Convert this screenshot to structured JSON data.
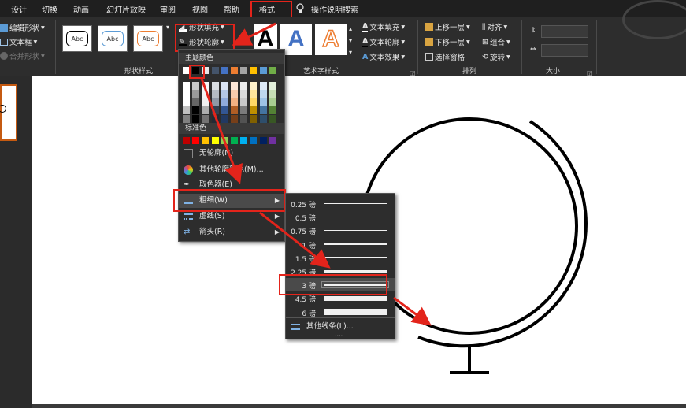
{
  "menubar": {
    "tabs": [
      "设计",
      "切换",
      "动画",
      "幻灯片放映",
      "审阅",
      "视图",
      "帮助",
      "格式"
    ],
    "active_tab": "格式",
    "search_label": "操作说明搜索"
  },
  "ribbon": {
    "insert_shapes": {
      "edit_shape": "编辑形状",
      "text_box": "文本框",
      "merge_shapes": "合并形状"
    },
    "shape_styles": {
      "group_label": "形状样式",
      "gallery": [
        "Abc",
        "Abc",
        "Abc"
      ],
      "shape_fill": "形状填充",
      "shape_outline": "形状轮廓"
    },
    "wordart": {
      "group_label": "艺术字样式",
      "letters": [
        "A",
        "A",
        "A"
      ],
      "text_fill": "文本填充",
      "text_outline": "文本轮廓",
      "text_effects": "文本效果"
    },
    "arrange": {
      "group_label": "排列",
      "bring_forward": "上移一层",
      "send_backward": "下移一层",
      "selection_pane": "选择窗格",
      "align": "对齐",
      "group": "组合",
      "rotate": "旋转"
    },
    "size": {
      "group_label": "大小",
      "height": "",
      "width": ""
    }
  },
  "outline_menu": {
    "theme_colors_label": "主题颜色",
    "standard_colors_label": "标准色",
    "no_outline": "无轮廓(N)",
    "more_colors": "其他轮廓颜色(M)...",
    "eyedropper": "取色器(E)",
    "weight": "粗细(W)",
    "dashes": "虚线(S)",
    "arrows": "箭头(R)",
    "theme_colors": [
      "#ffffff",
      "#000000",
      "#e7e6e6",
      "#44546a",
      "#4472c4",
      "#ed7d31",
      "#a5a5a5",
      "#ffc000",
      "#5b9bd5",
      "#70ad47"
    ],
    "standard_colors": [
      "#c00000",
      "#ff0000",
      "#ffc000",
      "#ffff00",
      "#92d050",
      "#00b050",
      "#00b0f0",
      "#0070c0",
      "#002060",
      "#7030a0"
    ]
  },
  "weight_menu": {
    "items": [
      {
        "label": "0.25 磅",
        "thickness": 0.25
      },
      {
        "label": "0.5 磅",
        "thickness": 0.5
      },
      {
        "label": "0.75 磅",
        "thickness": 0.75
      },
      {
        "label": "1 磅",
        "thickness": 1
      },
      {
        "label": "1.5 磅",
        "thickness": 1.5
      },
      {
        "label": "2.25 磅",
        "thickness": 2.25
      },
      {
        "label": "3 磅",
        "thickness": 3
      },
      {
        "label": "4.5 磅",
        "thickness": 4.5
      },
      {
        "label": "6 磅",
        "thickness": 6
      }
    ],
    "selected": "3 磅",
    "more_lines": "其他线条(L)..."
  },
  "colors": {
    "highlight": "#e3241b",
    "menu_bg": "#2d2d2d",
    "hover": "#4a4a4a"
  }
}
